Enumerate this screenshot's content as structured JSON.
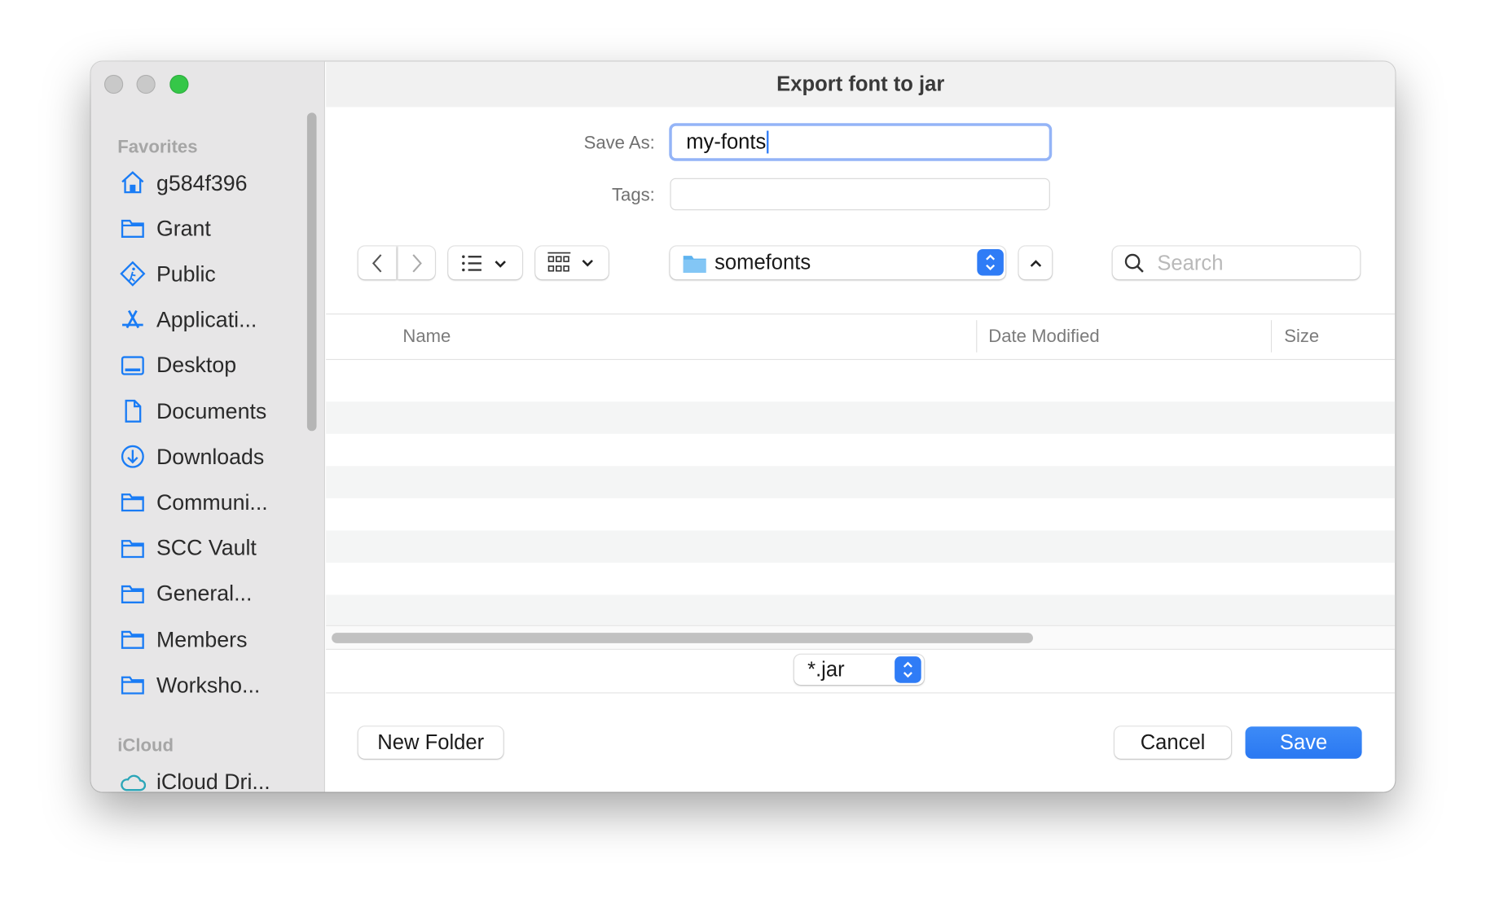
{
  "window": {
    "title": "Export font to jar"
  },
  "sidebar": {
    "favorites_label": "Favorites",
    "items": [
      {
        "label": "g584f396",
        "icon": "home-icon"
      },
      {
        "label": "Grant",
        "icon": "folder-icon"
      },
      {
        "label": "Public",
        "icon": "public-icon"
      },
      {
        "label": "Applicati...",
        "icon": "applications-icon"
      },
      {
        "label": "Desktop",
        "icon": "desktop-icon"
      },
      {
        "label": "Documents",
        "icon": "document-icon"
      },
      {
        "label": "Downloads",
        "icon": "download-icon"
      },
      {
        "label": "Communi...",
        "icon": "folder-icon"
      },
      {
        "label": "SCC Vault",
        "icon": "folder-icon"
      },
      {
        "label": "General...",
        "icon": "folder-icon"
      },
      {
        "label": "Members",
        "icon": "folder-icon"
      },
      {
        "label": "Worksho...",
        "icon": "folder-icon"
      }
    ],
    "icloud_label": "iCloud",
    "icloud_items": [
      {
        "label": "iCloud Dri...",
        "icon": "cloud-icon"
      }
    ]
  },
  "form": {
    "save_as_label": "Save As:",
    "save_as_value": "my-fonts",
    "tags_label": "Tags:",
    "tags_value": ""
  },
  "toolbar": {
    "location": "somefonts",
    "search_placeholder": "Search"
  },
  "table": {
    "columns": [
      "Name",
      "Date Modified",
      "Size"
    ],
    "rows": []
  },
  "filter": {
    "selected": "*.jar"
  },
  "buttons": {
    "new_folder": "New Folder",
    "cancel": "Cancel",
    "save": "Save"
  },
  "colors": {
    "accent": "#2f7cf6",
    "sidebar_icon": "#1a7cf5"
  }
}
